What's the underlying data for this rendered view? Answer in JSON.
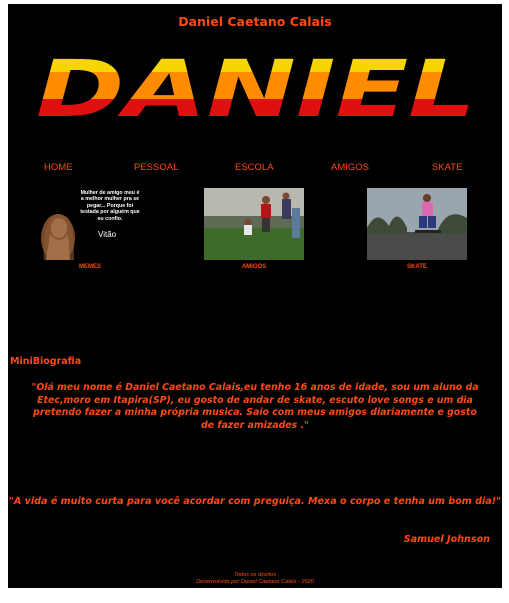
{
  "header": {
    "title": "Daniel Caetano Calais",
    "logo_text": "DANIEL"
  },
  "nav": [
    {
      "label": "HOME"
    },
    {
      "label": "PESSOAL"
    },
    {
      "label": "ESCOLA"
    },
    {
      "label": "AMIGOS"
    },
    {
      "label": "SKATE"
    }
  ],
  "gallery": {
    "memes": {
      "caption": "MEMES",
      "meme_text": "Mulher de amigo meu é a melhor mulher pra se pegar... Porque foi testada por alguém que eu confio.",
      "meme_name": "Vitão"
    },
    "amigos": {
      "caption": "AMIGOS"
    },
    "skate": {
      "caption": "SKATE"
    }
  },
  "bio": {
    "heading": "MiniBiografia",
    "text": "\"Olá meu nome é Daniel Caetano Calais,eu tenho 16 anos de idade, sou um aluno da Etec,moro em Itapira(SP), eu gosto de andar de skate, escuto love songs e um dia pretendo fazer a minha própria musica. Saio com meus amigos diariamente e gosto de fazer amizades .\""
  },
  "quote": {
    "text": "\"A vida é muito curta para você acordar com preguiça. Mexa o corpo e tenha um bom dia!\"",
    "author": "Samuel Johnson"
  },
  "footer": {
    "line1": "Todos os direitos",
    "line2": "Desenvolvido por Daniel Caetano Calais - 2020"
  },
  "colors": {
    "accent": "#ff4a12",
    "background": "#000000",
    "logo_yellow": "#f6d500",
    "logo_orange": "#ff8c00",
    "logo_red": "#e01010"
  }
}
